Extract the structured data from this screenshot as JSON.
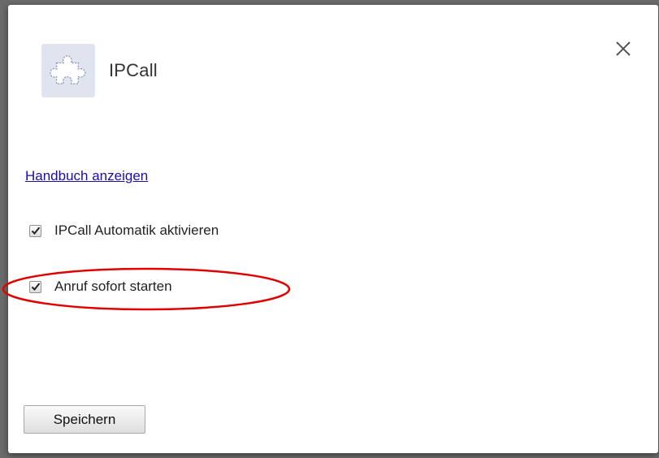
{
  "dialog": {
    "title": "IPCall",
    "icon": "puzzle-piece-icon",
    "close_icon": "close-icon"
  },
  "options": {
    "manual_link": "Handbuch anzeigen",
    "items": [
      {
        "label": "IPCall Automatik aktivieren",
        "checked": true
      },
      {
        "label": "Anruf sofort starten",
        "checked": true
      }
    ]
  },
  "footer": {
    "save_label": "Speichern"
  },
  "annotation": {
    "color": "#e00000"
  }
}
